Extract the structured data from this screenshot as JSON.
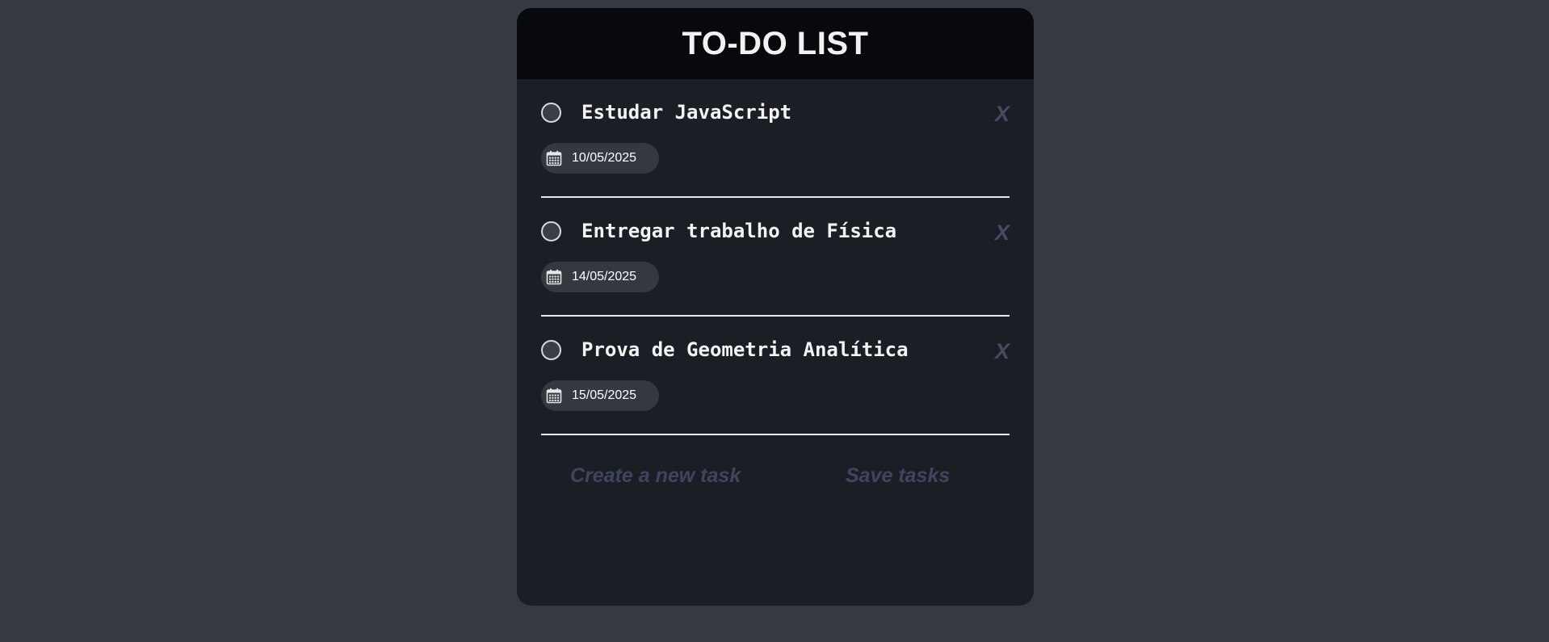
{
  "app": {
    "title": "TO-DO LIST"
  },
  "tasks": [
    {
      "title": "Estudar JavaScript",
      "date": "10/05/2025",
      "delete_label": "X",
      "completed": false
    },
    {
      "title": "Entregar trabalho de Física",
      "date": "14/05/2025",
      "delete_label": "X",
      "completed": false
    },
    {
      "title": "Prova de Geometria Analítica",
      "date": "15/05/2025",
      "delete_label": "X",
      "completed": false
    }
  ],
  "actions": {
    "create_label": "Create a new task",
    "save_label": "Save tasks"
  },
  "icons": {
    "check": "circle-checkbox-icon",
    "calendar": "calendar-icon",
    "delete": "close-icon"
  },
  "colors": {
    "page_background": "#353941",
    "card_background": "#1b1e25",
    "header_background": "#08090c",
    "text": "#f3f3f3",
    "muted_accent": "#3e455e",
    "date_pill": "#343840"
  }
}
